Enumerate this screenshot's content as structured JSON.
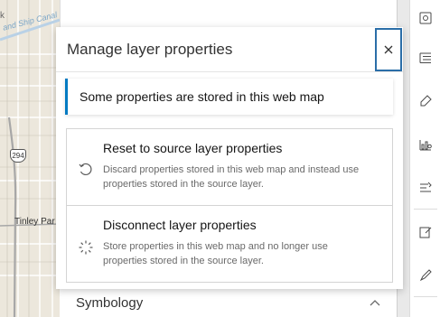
{
  "map": {
    "labels": {
      "k": "k",
      "canal": "and Ship Canal",
      "tinley": "Tinley Par"
    },
    "shield": "294"
  },
  "panel": {
    "symbology_label": "Symbology",
    "symbology_icon": "chevron-up-icon"
  },
  "dialog": {
    "title": "Manage layer properties",
    "close_icon": "close-icon",
    "notice": "Some properties are stored in this web map",
    "options": [
      {
        "title": "Reset to source layer properties",
        "description": "Discard properties stored in this web map and instead use properties stored in the source layer.",
        "icon": "reset-icon"
      },
      {
        "title": "Disconnect layer properties",
        "description": "Store properties in this web map and no longer use properties stored in the source layer.",
        "icon": "disconnect-icon"
      }
    ]
  },
  "action_bar": {
    "icons": [
      "settings-icon",
      "list-icon",
      "tag-icon",
      "chart-icon",
      "filter-icon",
      "edit-icon",
      "pen-icon"
    ]
  },
  "colors": {
    "accent": "#007ac2",
    "focus": "#2b6ea8"
  }
}
